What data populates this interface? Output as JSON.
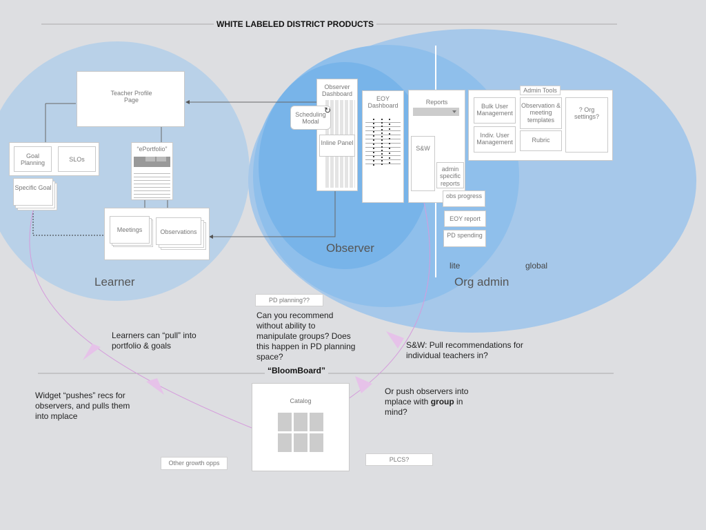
{
  "header": {
    "title": "WHITE LABELED DISTRICT PRODUCTS",
    "section2": "“BloomBoard”"
  },
  "zones": {
    "learner": "Learner",
    "observer": "Observer",
    "org_admin": "Org admin",
    "lite": "lite",
    "global": "global"
  },
  "learner": {
    "teacher_profile": "Teacher Profile Page",
    "goal_planning": "Goal Planning",
    "slos": "SLOs",
    "specific_goal": "Specific Goal",
    "eportfolio": "“ePortfolio”",
    "meetings": "Meetings",
    "observations": "Observations"
  },
  "observer": {
    "dashboard": "Observer Dashboard",
    "scheduling_modal": "Scheduling Modal",
    "inline_panel": "Inline Panel",
    "eoy_dashboard": "EOY Dashboard",
    "reports": "Reports",
    "sw": "S&W",
    "admin_specific_reports": "admin specific reports",
    "obs_progress": "obs progress",
    "eoy_report": "EOY report",
    "pd_spending": "PD spending"
  },
  "admin_tools": {
    "title": "Admin Tools",
    "bulk_user": "Bulk User Management",
    "indiv_user": "Indiv. User Management",
    "observation_templates": "Observation & meeting templates",
    "rubric": "Rubric",
    "org_settings": "? Org settings?"
  },
  "notes": {
    "learners_pull": "Learners can “pull” into portfolio & goals",
    "pd_planning_tag": "PD planning??",
    "recommend_question": "Can you recommend without ability to manipulate groups? Does this happen in PD planning space?",
    "sw_question": "S&W: Pull recommendations for individual teachers in?",
    "widget_pushes": "Widget “pushes” recs for observers, and pulls them into mplace",
    "push_observers_pre": "Or push observers into mplace with ",
    "push_observers_bold": "group",
    "push_observers_post": " in mind?",
    "catalog": "Catalog",
    "other_growth": "Other growth opps",
    "plcs": "PLCS?"
  },
  "colors": {
    "background": "#dddee1",
    "circle_light": "#b9d1e8",
    "circle_mid": "#9dc5ea",
    "circle_strong": "#79b7ea",
    "arrow_pink": "#d59bdc"
  }
}
